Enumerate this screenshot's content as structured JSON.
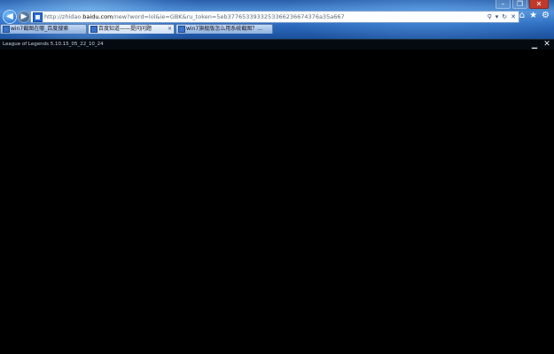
{
  "browser": {
    "address": {
      "url_prefix": "http://zhidao.",
      "url_domain": "baidu.com",
      "url_suffix": "/new?word=lol&ie=GBK&ru_token=5eb37765339332533662366743​76a35a667"
    },
    "tabs": [
      {
        "label": "win7截图在哪_百度搜索",
        "active": false
      },
      {
        "label": "百度知道——提问问题",
        "active": true,
        "close": "×"
      },
      {
        "label": "win7旗舰版怎么用系统截图？...",
        "active": false
      }
    ],
    "icons": [
      "back-arrow-icon",
      "forward-arrow-icon",
      "search-icon",
      "refresh-icon",
      "stop-icon",
      "home-icon",
      "favorites-star-icon",
      "tools-gear-icon"
    ]
  },
  "game_window": {
    "title": "League of Legends 5.10.15_05_22_10_24",
    "background": "#000000"
  }
}
